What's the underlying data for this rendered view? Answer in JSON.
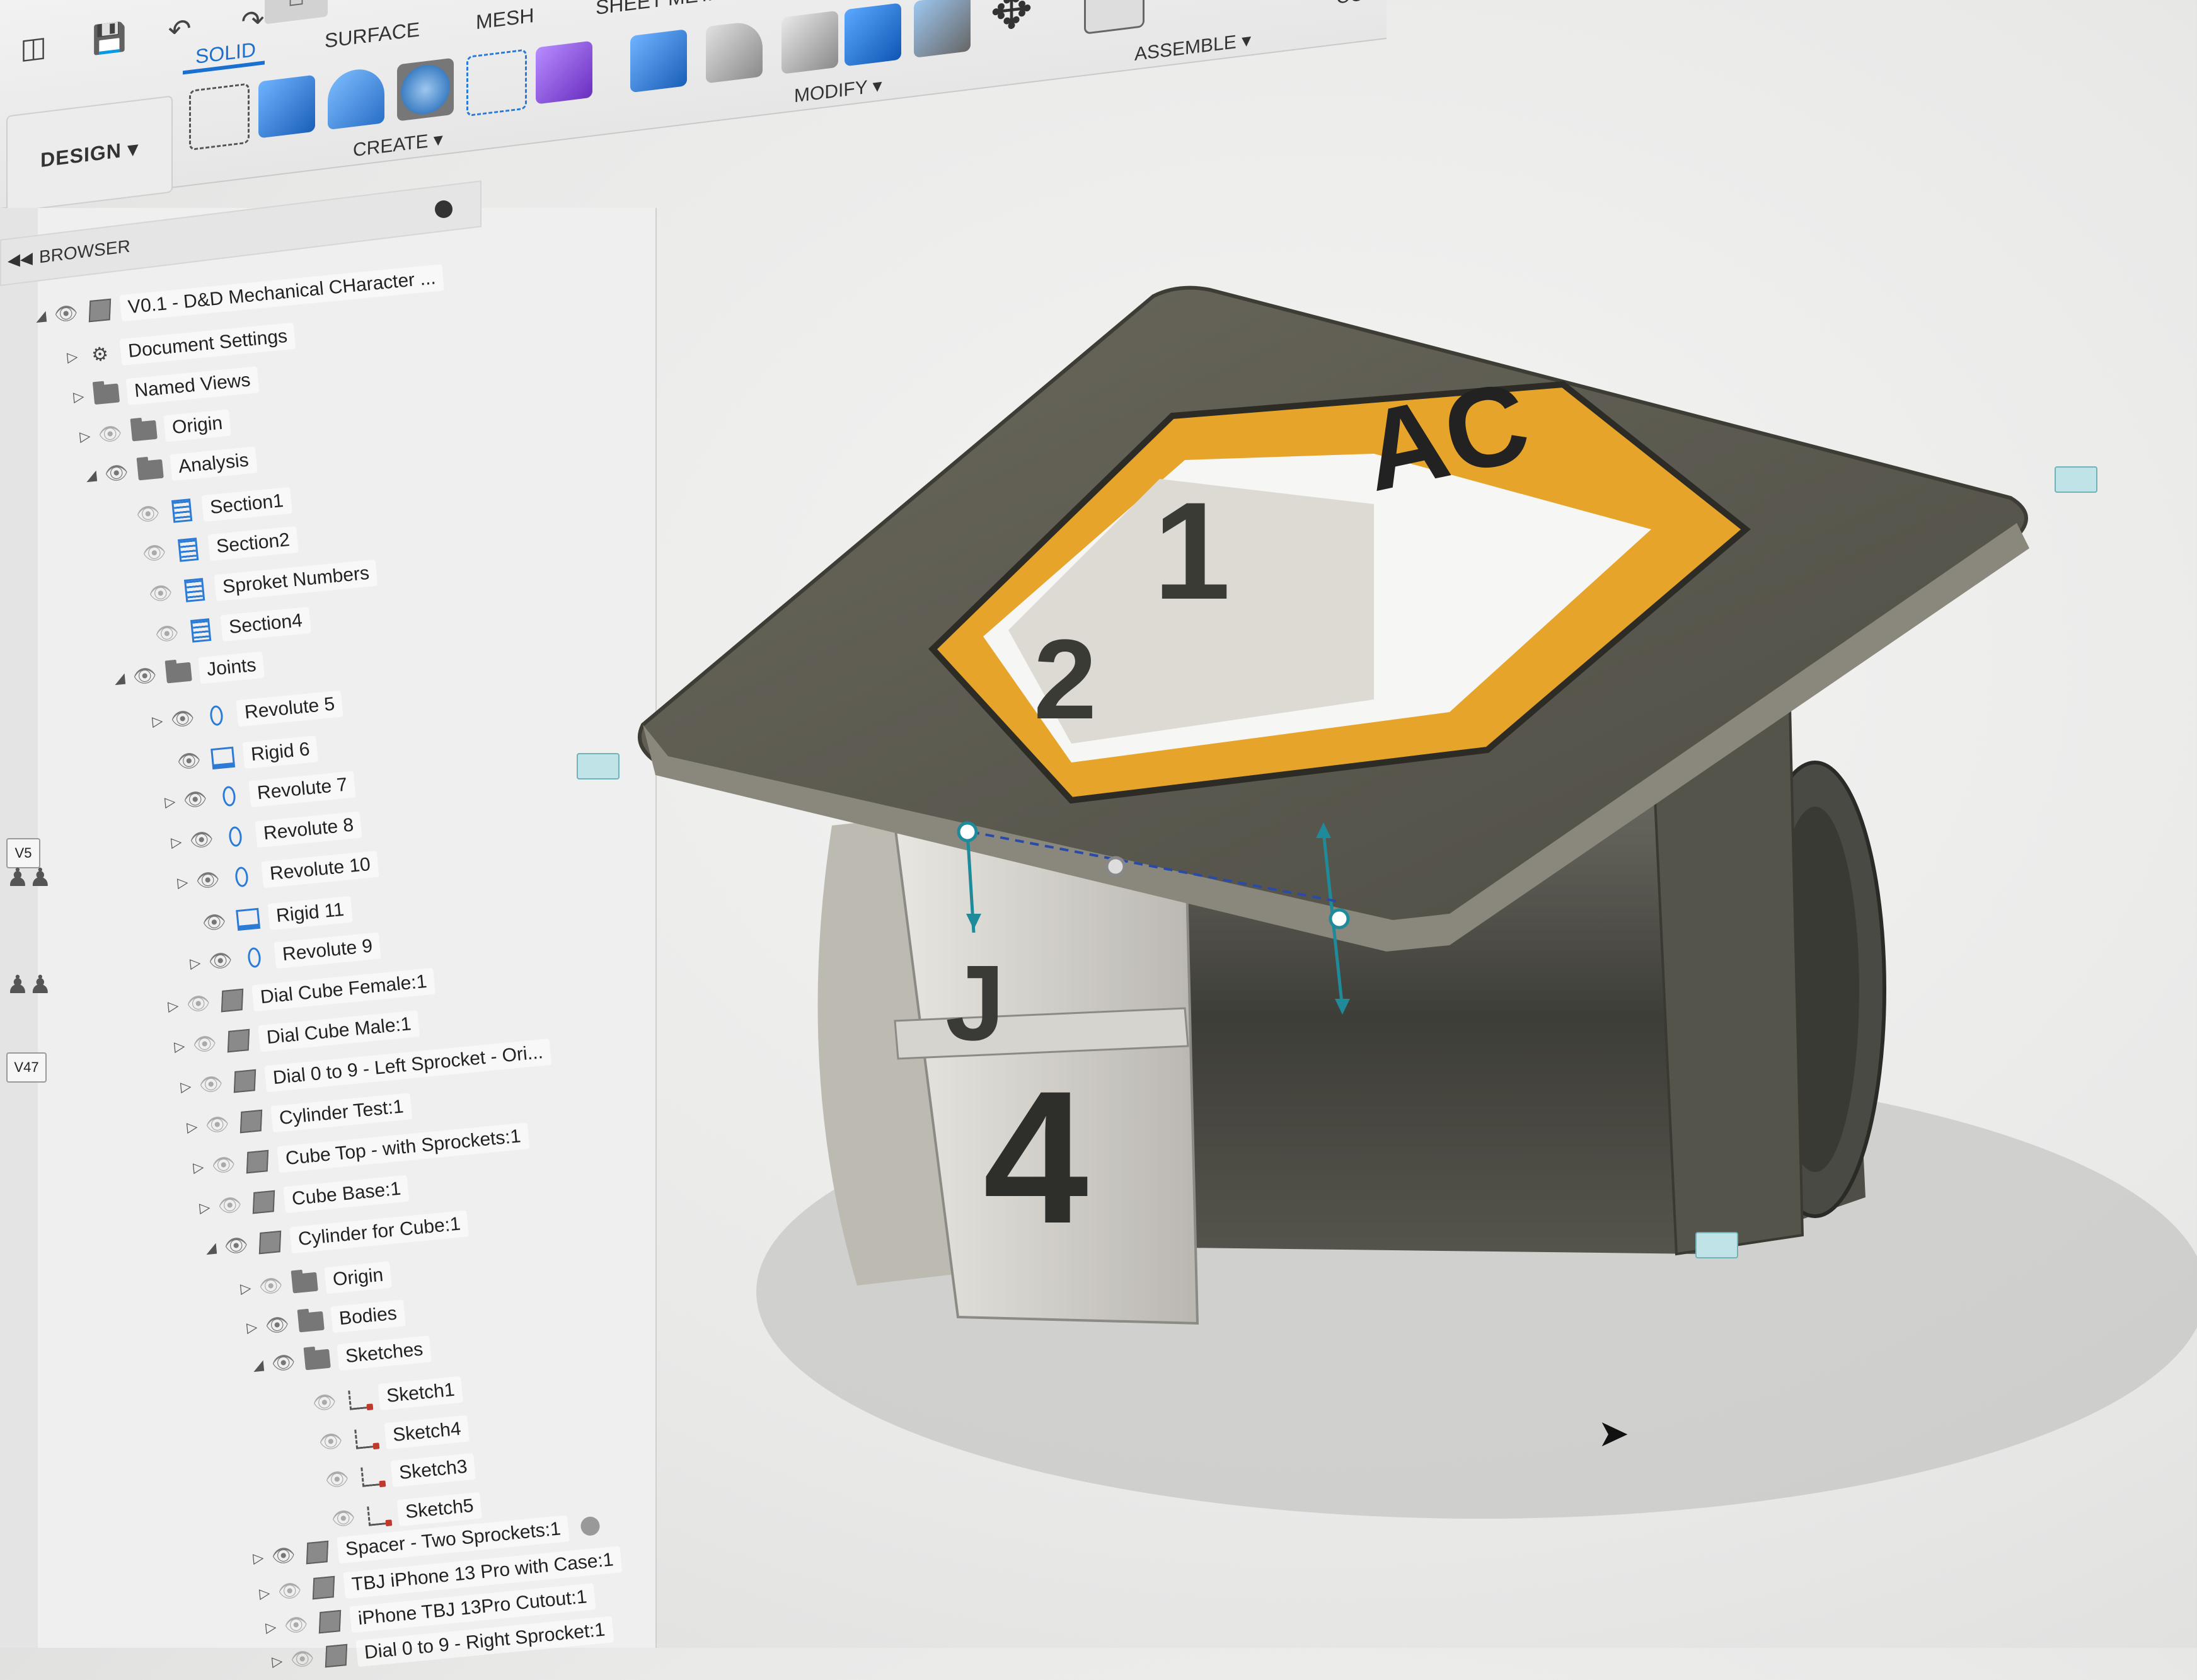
{
  "toolbar": {
    "workspace": "DESIGN",
    "tabs": [
      "SOLID",
      "SURFACE",
      "MESH",
      "SHEET METAL"
    ],
    "active_tab": "SOLID",
    "groups": {
      "create": "CREATE",
      "modify": "MODIFY",
      "assemble": "ASSEMBLE",
      "configure": "CONFIGU"
    },
    "icons": [
      "file-menu-icon",
      "save-icon",
      "undo-icon",
      "redo-icon",
      "home-icon"
    ]
  },
  "browser": {
    "title": "BROWSER",
    "root": "V0.1 - D&D Mechanical CHaracter ...",
    "items": [
      {
        "label": "Document Settings"
      },
      {
        "label": "Named Views"
      },
      {
        "label": "Origin"
      },
      {
        "label": "Analysis"
      },
      {
        "label": "Section1"
      },
      {
        "label": "Section2"
      },
      {
        "label": "Sproket Numbers"
      },
      {
        "label": "Section4"
      },
      {
        "label": "Joints"
      },
      {
        "label": "Revolute 5"
      },
      {
        "label": "Rigid 6"
      },
      {
        "label": "Revolute 7"
      },
      {
        "label": "Revolute 8"
      },
      {
        "label": "Revolute 10"
      },
      {
        "label": "Rigid 11"
      },
      {
        "label": "Revolute 9"
      },
      {
        "label": "Dial Cube Female:1"
      },
      {
        "label": "Dial Cube Male:1"
      },
      {
        "label": "Dial 0 to 9 - Left Sprocket - Ori..."
      },
      {
        "label": "Cylinder Test:1"
      },
      {
        "label": "Cube Top - with Sprockets:1"
      },
      {
        "label": "Cube Base:1"
      },
      {
        "label": "Cylinder for Cube:1"
      },
      {
        "label": "Origin"
      },
      {
        "label": "Bodies"
      },
      {
        "label": "Sketches"
      },
      {
        "label": "Sketch1"
      },
      {
        "label": "Sketch4"
      },
      {
        "label": "Sketch3"
      },
      {
        "label": "Sketch5"
      },
      {
        "label": "Spacer - Two Sprockets:1"
      },
      {
        "label": "TBJ iPhone 13 Pro with Case:1"
      },
      {
        "label": "iPhone TBJ 13Pro Cutout:1"
      },
      {
        "label": "Dial 0 to 9 - Right Sprocket:1"
      }
    ]
  },
  "side_controls": [
    "V5",
    "V47"
  ],
  "model": {
    "logo_text": "AC",
    "digits": [
      "1",
      "2",
      "J",
      "4"
    ]
  }
}
